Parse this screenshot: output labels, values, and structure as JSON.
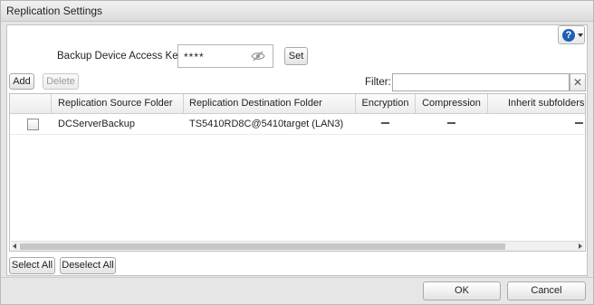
{
  "dialog": {
    "title": "Replication Settings"
  },
  "help": {
    "icon": "help-icon",
    "glyph": "?"
  },
  "access_key": {
    "label": "Backup Device Access Key:",
    "value": "****",
    "toggle_icon": "eye-slash-icon",
    "set_label": "Set"
  },
  "toolbar": {
    "add_label": "Add",
    "delete_label": "Delete",
    "filter_label": "Filter:",
    "filter_value": "",
    "clear_glyph": "✕"
  },
  "table": {
    "columns": [
      "Replication Source Folder",
      "Replication Destination Folder",
      "Encryption",
      "Compression",
      "Inherit subfolders' ac"
    ],
    "rows": [
      {
        "checked": false,
        "source": "DCServerBackup",
        "destination": "TS5410RD8C@5410target (LAN3)",
        "encryption": "—",
        "compression": "—",
        "inherit": "—"
      }
    ]
  },
  "selection": {
    "select_all_label": "Select All",
    "deselect_all_label": "Deselect All"
  },
  "footer": {
    "ok_label": "OK",
    "cancel_label": "Cancel"
  },
  "colors": {
    "help_accent": "#1d5fb5",
    "dialog_bg": "#e6e6e6"
  }
}
